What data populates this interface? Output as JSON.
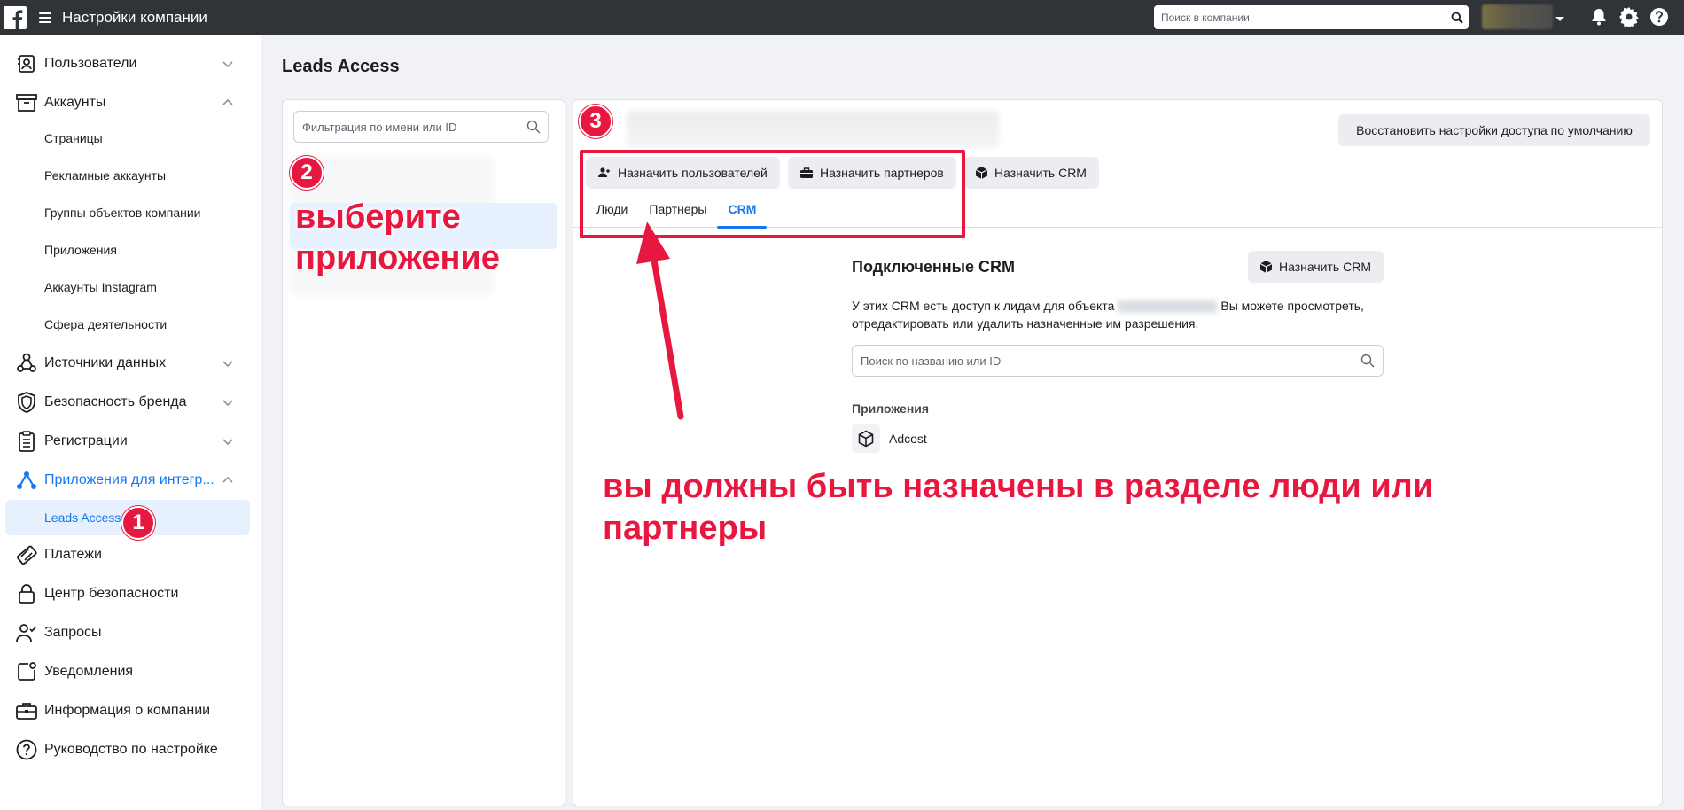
{
  "topbar": {
    "title": "Настройки компании",
    "search_placeholder": "Поиск в компании",
    "icons": [
      "facebook-logo",
      "hamburger-icon",
      "search-icon",
      "caret-down-icon",
      "bell-icon",
      "gear-icon",
      "help-icon"
    ]
  },
  "sidebar": {
    "items": [
      {
        "label": "Пользователи",
        "icon": "users-icon"
      },
      {
        "label": "Аккаунты",
        "icon": "archive-icon"
      },
      {
        "label": "Страницы"
      },
      {
        "label": "Рекламные аккаунты"
      },
      {
        "label": "Группы объектов компании"
      },
      {
        "label": "Приложения"
      },
      {
        "label": "Аккаунты Instagram"
      },
      {
        "label": "Сфера деятельности"
      },
      {
        "label": "Источники данных",
        "icon": "data-sources-icon"
      },
      {
        "label": "Безопасность бренда",
        "icon": "shield-icon"
      },
      {
        "label": "Регистрации",
        "icon": "clipboard-icon"
      },
      {
        "label": "Приложения для интегр...",
        "icon": "integrations-icon"
      },
      {
        "label": "Leads Access"
      },
      {
        "label": "Платежи",
        "icon": "card-icon"
      },
      {
        "label": "Центр безопасности",
        "icon": "lock-icon"
      },
      {
        "label": "Запросы",
        "icon": "person-check-icon"
      },
      {
        "label": "Уведомления",
        "icon": "notification-icon"
      },
      {
        "label": "Информация о компании",
        "icon": "briefcase-icon"
      },
      {
        "label": "Руководство по настройке",
        "icon": "question-icon"
      }
    ]
  },
  "main": {
    "page_title": "Leads Access",
    "filter_placeholder": "Фильтрация по имени или ID",
    "restore_button": "Восстановить настройки доступа по умолчанию",
    "assign_users": "Назначить пользователей",
    "assign_partners": "Назначить партнеров",
    "assign_crm": "Назначить CRM",
    "tabs": [
      "Люди",
      "Партнеры",
      "CRM"
    ],
    "crm": {
      "title": "Подключенные CRM",
      "assign_button": "Назначить CRM",
      "desc_part1": "У этих CRM есть доступ к лидам для объекта",
      "desc_part2": "Вы можете просмотреть,",
      "desc_line2": "отредактировать или удалить назначенные им разрешения.",
      "search_placeholder": "Поиск по названию или ID",
      "apps_heading": "Приложения",
      "app_name": "Adcost"
    }
  },
  "annotations": {
    "badge1": "1",
    "badge2": "2",
    "badge3": "3",
    "text_select_line1": "выберите",
    "text_select_line2": "приложение",
    "text_assign_line1": "вы должны быть назначены в разделе люди или",
    "text_assign_line2": "партнеры",
    "color": "#e8173f"
  },
  "colors": {
    "topbar": "#303338",
    "accent": "#1877f2",
    "page_bg": "#f0f2f5"
  }
}
